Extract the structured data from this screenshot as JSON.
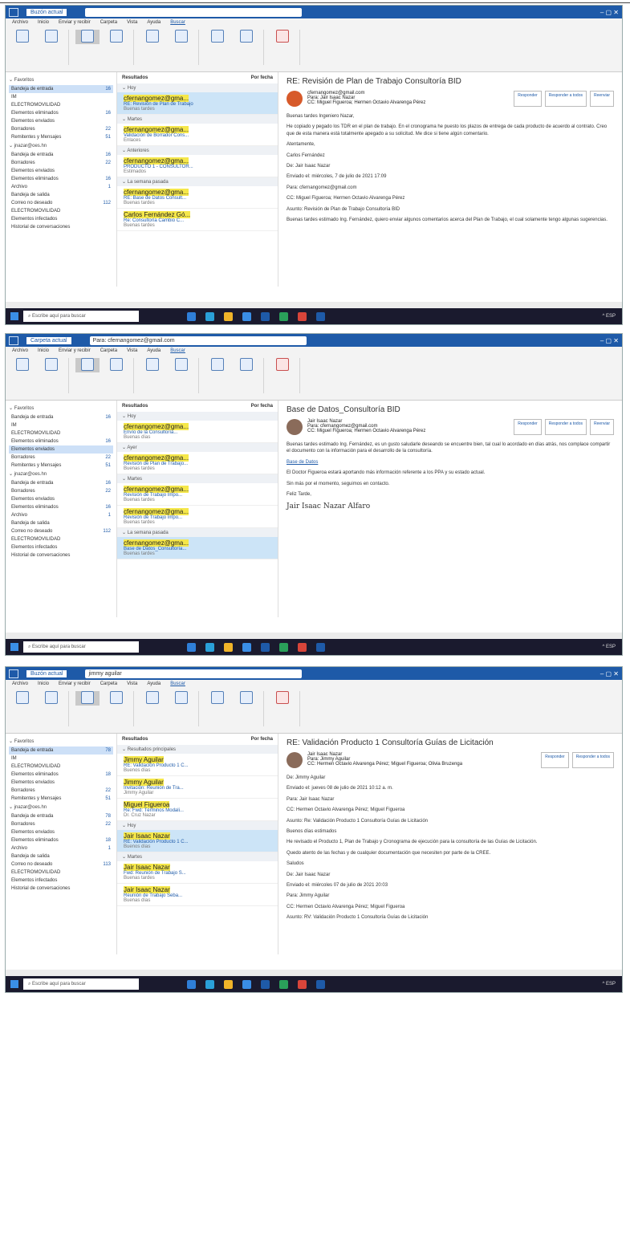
{
  "shots": [
    {
      "view_label": "Buzón actual",
      "search_text": "",
      "menu": [
        "Archivo",
        "Inicio",
        "Enviar y recibir",
        "Carpeta",
        "Vista",
        "Ayuda",
        "Buscar"
      ],
      "nav": {
        "favorites_label": "Favoritos",
        "folders": [
          {
            "label": "Bandeja de entrada",
            "count": "16"
          },
          {
            "label": "IM",
            "count": ""
          },
          {
            "label": "ELECTROMOVILIDAD",
            "count": ""
          },
          {
            "label": "Elementos eliminados",
            "count": "16"
          },
          {
            "label": "Elementos enviados",
            "count": ""
          },
          {
            "label": "Borradores",
            "count": "22"
          },
          {
            "label": "Remitentes y Mensajes",
            "count": "51"
          }
        ],
        "account_label": "jnazar@oes.hn",
        "account_folders": [
          {
            "label": "Bandeja de entrada",
            "count": "16"
          },
          {
            "label": "Borradores",
            "count": "22"
          },
          {
            "label": "Elementos enviados",
            "count": ""
          },
          {
            "label": "Elementos eliminados",
            "count": "16"
          },
          {
            "label": "Archivo",
            "count": "1"
          },
          {
            "label": "Bandeja de salida",
            "count": ""
          },
          {
            "label": "Correo no deseado",
            "count": "112"
          },
          {
            "label": "ELECTROMOVILIDAD",
            "count": ""
          },
          {
            "label": "Elementos infectados",
            "count": ""
          },
          {
            "label": "Historial de conversaciones",
            "count": ""
          }
        ]
      },
      "list": {
        "header": "Resultados",
        "sort": "Por fecha",
        "items": [
          {
            "group": "Hoy",
            "from": "cfernangomez@gma...",
            "sub": "RE: Revisión de Plan de Trabajo",
            "prev": "Buenas tardes",
            "sel": true
          },
          {
            "group": "Martes",
            "from": "cfernangomez@gma...",
            "sub": "Validación de Borrador Cons...",
            "prev": "Enlaces",
            "sel": false
          },
          {
            "group": "Anteriores",
            "from": "cfernangomez@gma...",
            "sub": "PRODUCTO 1 - CONSULTOR...",
            "prev": "Estimados",
            "sel": false
          },
          {
            "group": "La semana pasada",
            "from": "cfernangomez@gma...",
            "sub": "RE: Base de Datos Consult...",
            "prev": "Buenas tardes",
            "sel": false
          },
          {
            "group": "",
            "from": "Carlos Fernández Gó...",
            "sub": "Re: Consultoría Cambio C...",
            "prev": "Buenas tardes",
            "sel": false
          }
        ]
      },
      "read": {
        "subject": "RE: Revisión de Plan de Trabajo Consultoría BID",
        "from": "cfernangomez@gmail.com",
        "to": "Para: Jair Isaac Nazar",
        "cc": "CC: Miguel Figueroa; Hermen Octavio Alvarenga Pérez",
        "actions": [
          "Responder",
          "Responder a todos",
          "Reenviar"
        ],
        "paras": [
          "Buenas tardes Ingeniero Nazar,",
          "He copiado y pegado los TDR en el plan de trabajo. En el cronograma he puesto los plazos de entrega de cada producto de acuerdo al contrato. Creo que de esta manera está totalmente apegado a su solicitud. Me dice si tiene algún comentario.",
          "Atentamente,",
          "Carlos Fernández",
          "De: Jair Isaac Nazar",
          "Enviado el: miércoles, 7 de julio de 2021 17:09",
          "Para: cfernangomez@gmail.com",
          "CC: Miguel Figueroa; Hermen Octavio Alvarenga Pérez",
          "Asunto: Revisión de Plan de Trabajo Consultoría BID",
          "Buenas tardes estimado Ing. Fernández, quiero enviar algunos comentarios acerca del Plan de Trabajo, el cual solamente tengo algunas sugerencias."
        ]
      },
      "taskbar": "Escribe aquí para buscar"
    },
    {
      "view_label": "Carpeta actual",
      "search_text": "Para: cfernangomez@gmail.com",
      "menu": [
        "Archivo",
        "Inicio",
        "Enviar y recibir",
        "Carpeta",
        "Vista",
        "Ayuda",
        "Buscar"
      ],
      "nav": {
        "favorites_label": "Favoritos",
        "folders": [
          {
            "label": "Bandeja de entrada",
            "count": "16"
          },
          {
            "label": "IM",
            "count": ""
          },
          {
            "label": "ELECTROMOVILIDAD",
            "count": ""
          },
          {
            "label": "Elementos eliminados",
            "count": "16"
          },
          {
            "label": "Elementos enviados",
            "count": ""
          },
          {
            "label": "Borradores",
            "count": "22"
          },
          {
            "label": "Remitentes y Mensajes",
            "count": "51"
          }
        ],
        "account_label": "jnazar@oes.hn",
        "account_folders": [
          {
            "label": "Bandeja de entrada",
            "count": "16"
          },
          {
            "label": "Borradores",
            "count": "22"
          },
          {
            "label": "Elementos enviados",
            "count": ""
          },
          {
            "label": "Elementos eliminados",
            "count": "16"
          },
          {
            "label": "Archivo",
            "count": "1"
          },
          {
            "label": "Bandeja de salida",
            "count": ""
          },
          {
            "label": "Correo no deseado",
            "count": "112"
          },
          {
            "label": "ELECTROMOVILIDAD",
            "count": ""
          },
          {
            "label": "Elementos infectados",
            "count": ""
          },
          {
            "label": "Historial de conversaciones",
            "count": ""
          }
        ]
      },
      "list": {
        "header": "Resultados",
        "sort": "Por fecha",
        "items": [
          {
            "group": "Hoy",
            "from": "cfernangomez@gma...",
            "sub": "Envío de la Consultoría...",
            "prev": "Buenas días",
            "sel": false
          },
          {
            "group": "Ayer",
            "from": "cfernangomez@gma...",
            "sub": "Revisión de Plan de Trabajo...",
            "prev": "Buenas tardes",
            "sel": false
          },
          {
            "group": "Martes",
            "from": "cfernangomez@gma...",
            "sub": "Revisión de Trabajo Impo...",
            "prev": "Buenas tardes",
            "sel": false
          },
          {
            "group": "",
            "from": "cfernangomez@gma...",
            "sub": "Revisión de Trabajo Impo...",
            "prev": "Buenas tardes",
            "sel": false
          },
          {
            "group": "La semana pasada",
            "from": "cfernangomez@gma...",
            "sub": "Base de Datos_Consultoría...",
            "prev": "Buenas tardes",
            "sel": true
          }
        ]
      },
      "read": {
        "subject": "Base de Datos_Consultoría BID",
        "from": "Jair Isaac Nazar",
        "to": "Para: cfernangomez@gmail.com",
        "cc": "CC: Miguel Figueroa; Hermen Octavio Alvarenga Pérez",
        "actions": [
          "Responder",
          "Responder a todos",
          "Reenviar"
        ],
        "paras": [
          "Buenas tardes estimado Ing. Fernández, es un gusto saludarle deseando se encuentre bien, tal cual lo acordado en días atrás, nos complace compartir el documento con la información para el desarrollo de la consultoría.",
          "Base de Datos",
          "El Doctor Figueroa estará aportando más información referente a los PPA y su estado actual.",
          "Sin más por el momento, seguimos en contacto.",
          "Feliz Tarde,",
          "Jair Isaac Nazar Alfaro"
        ]
      },
      "taskbar": "Escribe aquí para buscar"
    },
    {
      "view_label": "Buzón actual",
      "search_text": "jimmy aguilar",
      "menu": [
        "Archivo",
        "Inicio",
        "Enviar y recibir",
        "Carpeta",
        "Vista",
        "Ayuda",
        "Buscar"
      ],
      "nav": {
        "favorites_label": "Favoritos",
        "folders": [
          {
            "label": "Bandeja de entrada",
            "count": "78"
          },
          {
            "label": "IM",
            "count": ""
          },
          {
            "label": "ELECTROMOVILIDAD",
            "count": ""
          },
          {
            "label": "Elementos eliminados",
            "count": "18"
          },
          {
            "label": "Elementos enviados",
            "count": ""
          },
          {
            "label": "Borradores",
            "count": "22"
          },
          {
            "label": "Remitentes y Mensajes",
            "count": "51"
          }
        ],
        "account_label": "jnazar@oes.hn",
        "account_folders": [
          {
            "label": "Bandeja de entrada",
            "count": "78"
          },
          {
            "label": "Borradores",
            "count": "22"
          },
          {
            "label": "Elementos enviados",
            "count": ""
          },
          {
            "label": "Elementos eliminados",
            "count": "18"
          },
          {
            "label": "Archivo",
            "count": "1"
          },
          {
            "label": "Bandeja de salida",
            "count": ""
          },
          {
            "label": "Correo no deseado",
            "count": "113"
          },
          {
            "label": "ELECTROMOVILIDAD",
            "count": ""
          },
          {
            "label": "Elementos infectados",
            "count": ""
          },
          {
            "label": "Historial de conversaciones",
            "count": ""
          }
        ]
      },
      "list": {
        "header": "Resultados",
        "sort": "Por fecha",
        "items": [
          {
            "group": "Resultados principales",
            "from": "Jimmy Aguilar",
            "sub": "RE: Validación Producto 1 C...",
            "prev": "Buenos días",
            "sel": false
          },
          {
            "group": "",
            "from": "Jimmy Aguilar",
            "sub": "Invitación: Reunión de Tra...",
            "prev": "Jimmy Aguilar",
            "sel": false
          },
          {
            "group": "",
            "from": "Miguel Figueroa",
            "sub": "Re: Fwd: Términos Modali...",
            "prev": "Dr. Cruz Nazar",
            "sel": false
          },
          {
            "group": "Hoy",
            "from": "Jair Isaac Nazar",
            "sub": "RE: Validación Producto 1 C...",
            "prev": "Buenos días",
            "sel": true
          },
          {
            "group": "Martes",
            "from": "Jair Isaac Nazar",
            "sub": "Fwd: Reunión de Trabajo S...",
            "prev": "Buenas tardes",
            "sel": false
          },
          {
            "group": "",
            "from": "Jair Isaac Nazar",
            "sub": "Reunión de Trabajo Seba...",
            "prev": "Buenas días",
            "sel": false
          }
        ]
      },
      "read": {
        "subject": "RE: Validación Producto 1 Consultoría Guías de Licitación",
        "from": "Jair Isaac Nazar",
        "to": "Para: Jimmy Aguilar",
        "cc": "CC: Hermen Octavio Alvarenga Pérez; Miguel Figueroa; Olivia Bruzenga",
        "actions": [
          "Responder",
          "Responder a todos"
        ],
        "paras": [
          "De: Jimmy Aguilar",
          "Enviado el: jueves 08 de julio de 2021 10:12 a. m.",
          "Para: Jair Isaac Nazar",
          "CC: Hermen Octavio Alvarenga Pérez; Miguel Figueroa",
          "Asunto: Re: Validación Producto 1 Consultoría Guías de Licitación",
          "Buenos días estimados",
          "He revisado el Producto 1, Plan de Trabajo y Cronograma de ejecución para la consultoría de las Guías de Licitación.",
          "Quedo atento de las fechas y de cualquier documentación que necesiten por parte de la CREE.",
          "Saludos",
          "De: Jair Isaac Nazar",
          "Enviado el: miércoles 07 de julio de 2021 20:03",
          "Para: Jimmy Aguilar",
          "CC: Hermen Octavio Alvarenga Pérez; Miguel Figueroa",
          "Asunto: RV: Validación Producto 1 Consultoría Guías de Licitación"
        ]
      },
      "taskbar": "Escribe aquí para buscar"
    }
  ]
}
